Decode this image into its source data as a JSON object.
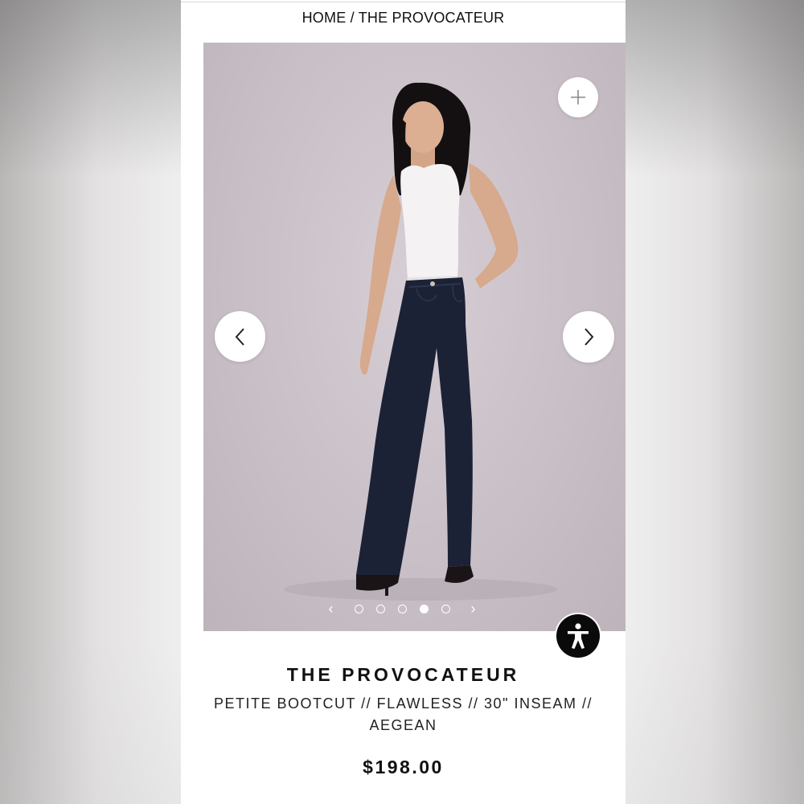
{
  "breadcrumb": {
    "home": "HOME",
    "separator": " / ",
    "current": "THE PROVOCATEUR"
  },
  "gallery": {
    "zoom_icon": "plus-icon",
    "prev_icon": "chevron-left-icon",
    "next_icon": "chevron-right-icon",
    "slide_count": 5,
    "active_slide": 4
  },
  "product": {
    "title": "THE PROVOCATEUR",
    "subtitle": "PETITE BOOTCUT // FLAWLESS // 30\" INSEAM // AEGEAN",
    "price": "$198.00"
  },
  "accessibility": {
    "icon": "accessibility-person-icon"
  },
  "colors": {
    "background_photo": "#c9c0c7",
    "jeans": "#1c2236",
    "accessibility_button": "#0a0a0a"
  }
}
